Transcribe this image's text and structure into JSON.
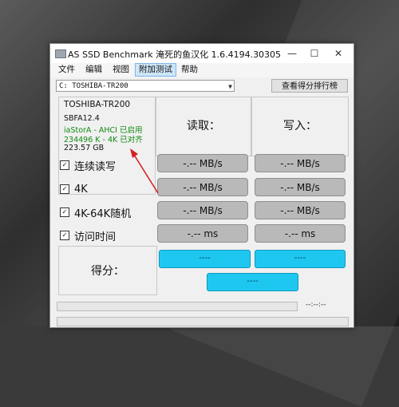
{
  "window": {
    "title": "AS SSD Benchmark 淹死的鱼汉化 1.6.4194.30305",
    "minimize": "—",
    "maximize": "☐",
    "close": "✕"
  },
  "menu": [
    {
      "label": "文件"
    },
    {
      "label": "编辑"
    },
    {
      "label": "视图"
    },
    {
      "label": "附加测试"
    },
    {
      "label": "帮助"
    }
  ],
  "drive": {
    "selected": "C: TOSHIBA-TR200",
    "rank_button": "查看得分排行榜"
  },
  "info": {
    "name": "TOSHIBA-TR200",
    "firmware": "SBFA12.4",
    "driver": "iaStorA - AHCI 已启用",
    "alignment": "234496 K - 4K 已对齐",
    "size": "223.57 GB"
  },
  "columns": {
    "read": "读取：",
    "write": "写入："
  },
  "rows": [
    {
      "label": "连续读写",
      "read": "-.-- MB/s",
      "write": "-.-- MB/s"
    },
    {
      "label": "4K",
      "read": "-.-- MB/s",
      "write": "-.-- MB/s"
    },
    {
      "label": "4K-64K随机",
      "read": "-.-- MB/s",
      "write": "-.-- MB/s"
    },
    {
      "label": "访问时间",
      "read": "-.-- ms",
      "write": "-.-- ms"
    }
  ],
  "score": {
    "label": "得分：",
    "read": "----",
    "write": "----",
    "total": "----"
  },
  "progress": {
    "timer": "--:--:--"
  },
  "colors": {
    "accent": "#1ec7f0",
    "ok_text": "#128a12",
    "arrow": "#d62020"
  }
}
